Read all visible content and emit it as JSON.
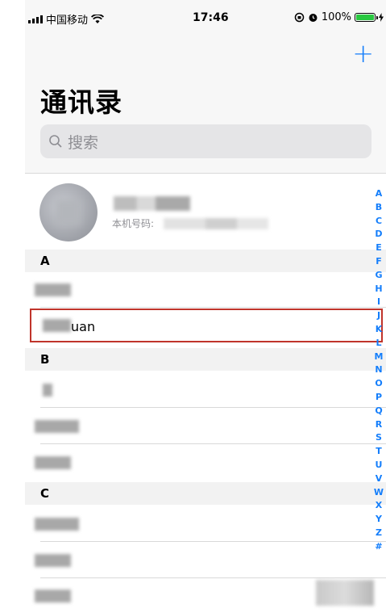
{
  "status_bar": {
    "carrier": "中国移动",
    "time": "17:46",
    "battery": "100%",
    "battery_level": 1.0
  },
  "header": {
    "title": "通讯录",
    "add_icon": "plus-icon"
  },
  "search": {
    "placeholder": "搜索"
  },
  "my_card": {
    "number_label": "本机号码:"
  },
  "sections": [
    {
      "letter": "A",
      "contacts": [
        "",
        "uan"
      ]
    },
    {
      "letter": "B",
      "contacts": [
        "",
        "",
        ""
      ]
    },
    {
      "letter": "C",
      "contacts": [
        "",
        "",
        ""
      ]
    }
  ],
  "index": [
    "A",
    "B",
    "C",
    "D",
    "E",
    "F",
    "G",
    "H",
    "I",
    "J",
    "K",
    "L",
    "M",
    "N",
    "O",
    "P",
    "Q",
    "R",
    "S",
    "T",
    "U",
    "V",
    "W",
    "X",
    "Y",
    "Z",
    "#"
  ],
  "colors": {
    "accent": "#147efb",
    "highlight_border": "#c0342b",
    "battery": "#28c840"
  }
}
